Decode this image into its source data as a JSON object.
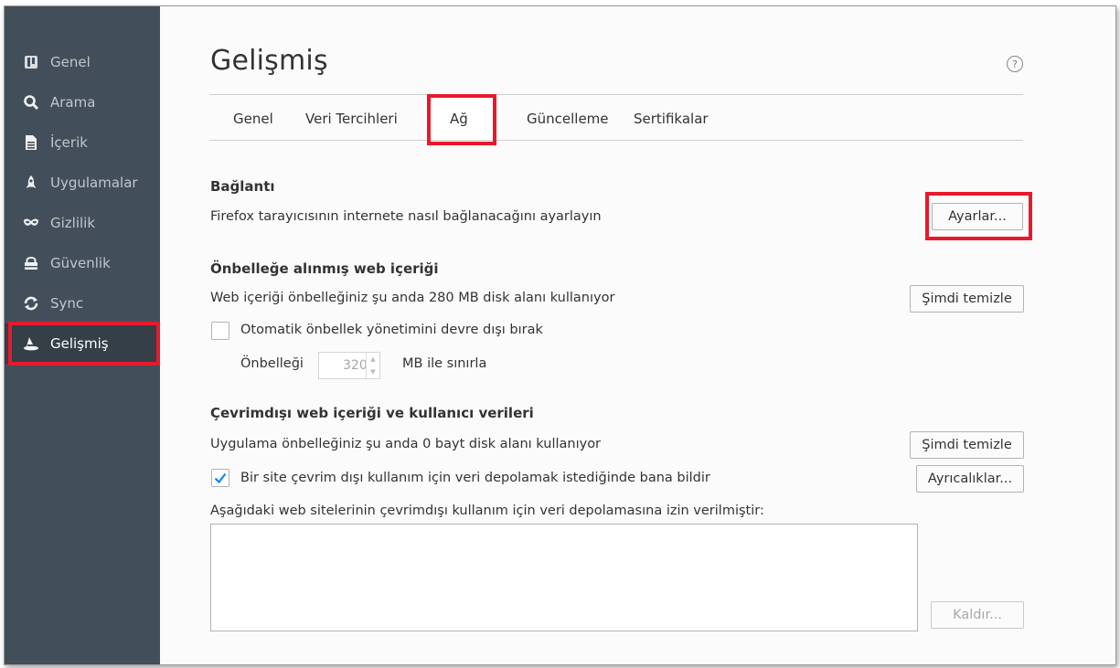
{
  "sidebar": {
    "items": [
      {
        "label": "Genel",
        "icon": "general-icon"
      },
      {
        "label": "Arama",
        "icon": "search-icon"
      },
      {
        "label": "İçerik",
        "icon": "document-icon"
      },
      {
        "label": "Uygulamalar",
        "icon": "rocket-icon"
      },
      {
        "label": "Gizlilik",
        "icon": "mask-icon"
      },
      {
        "label": "Güvenlik",
        "icon": "lock-icon"
      },
      {
        "label": "Sync",
        "icon": "sync-icon"
      },
      {
        "label": "Gelişmiş",
        "icon": "wizard-hat-icon"
      }
    ],
    "active": "Gelişmiş"
  },
  "page": {
    "title": "Gelişmiş",
    "help": "?"
  },
  "tabs": [
    "Genel",
    "Veri Tercihleri",
    "Ağ",
    "Güncelleme",
    "Sertifikalar"
  ],
  "active_tab": "Ağ",
  "connection": {
    "heading": "Bağlantı",
    "description": "Firefox tarayıcısının internete nasıl bağlanacağını ayarlayın",
    "settings_button": "Ayarlar..."
  },
  "cache": {
    "heading": "Önbelleğe alınmış web içeriği",
    "usage": "Web içeriği önbelleğiniz şu anda 280 MB disk alanı kullanıyor",
    "clear_button": "Şimdi temizle",
    "override_label": "Otomatik önbellek yönetimini devre dışı bırak",
    "limit_label": "Önbelleği",
    "limit_value": "320",
    "limit_unit": "MB ile sınırla"
  },
  "offline": {
    "heading": "Çevrimdışı web içeriği ve kullanıcı verileri",
    "usage": "Uygulama önbelleğiniz şu anda 0 bayt disk alanı kullanıyor",
    "clear_button": "Şimdi temizle",
    "notify_label": "Bir site çevrim dışı kullanım için veri depolamak istediğinde bana bildir",
    "notify_checked": true,
    "exceptions_button": "Ayrıcalıklar...",
    "list_label": "Aşağıdaki web sitelerinin çevrimdışı kullanım için veri depolamasına izin verilmiştir:",
    "remove_button": "Kaldır..."
  },
  "colors": {
    "sidebar": "#424f5a",
    "highlight": "#e8192c",
    "accent": "#0a84ff"
  }
}
